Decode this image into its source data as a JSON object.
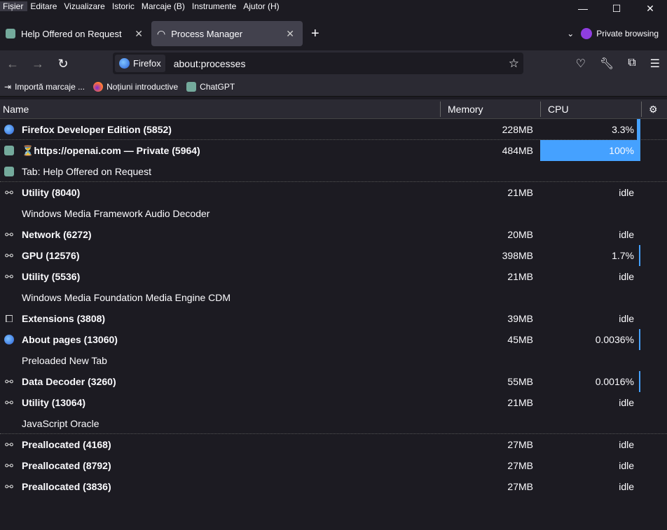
{
  "menu": [
    "Fișier",
    "Editare",
    "Vizualizare",
    "Istoric",
    "Marcaje (B)",
    "Instrumente",
    "Ajutor (H)"
  ],
  "window_controls": {
    "minimize": "—",
    "maximize": "☐",
    "close": "✕"
  },
  "tabs": [
    {
      "label": "Help Offered on Request",
      "icon": "chatgpt-icon"
    },
    {
      "label": "Process Manager",
      "icon": "gauge-icon"
    }
  ],
  "private_label": "Private browsing",
  "urlbar": {
    "identity": "Firefox",
    "url": "about:processes"
  },
  "bookmarks": [
    "Importă marcaje ...",
    "Noțiuni introductive",
    "ChatGPT"
  ],
  "columns": {
    "name": "Name",
    "memory": "Memory",
    "cpu": "CPU"
  },
  "accent": "#45a1ff",
  "rows": [
    {
      "icon": "firefox-icon",
      "name": "Firefox Developer Edition (5852)",
      "bold": true,
      "memory": "228MB",
      "cpu": "3.3%",
      "cpu_fraction": 0.033
    },
    {
      "icon": "chatgpt-icon",
      "name": "⏳https://openai.com — Private (5964)",
      "bold": true,
      "memory": "484MB",
      "cpu": "100%",
      "cpu_fraction": 1.0
    },
    {
      "icon": "chatgpt-icon",
      "name": "Tab: Help Offered on Request",
      "bold": false,
      "memory": "",
      "cpu": ""
    },
    {
      "icon": "plugin-icon",
      "name": "Utility (8040)",
      "bold": true,
      "memory": "21MB",
      "cpu": "idle"
    },
    {
      "icon": "",
      "name": "Windows Media Framework Audio Decoder",
      "bold": false,
      "memory": "",
      "cpu": ""
    },
    {
      "icon": "plugin-icon",
      "name": "Network (6272)",
      "bold": true,
      "memory": "20MB",
      "cpu": "idle"
    },
    {
      "icon": "plugin-icon",
      "name": "GPU (12576)",
      "bold": true,
      "memory": "398MB",
      "cpu": "1.7%",
      "cpu_fraction": 0.017
    },
    {
      "icon": "plugin-icon",
      "name": "Utility (5536)",
      "bold": true,
      "memory": "21MB",
      "cpu": "idle"
    },
    {
      "icon": "",
      "name": "Windows Media Foundation Media Engine CDM",
      "bold": false,
      "memory": "",
      "cpu": ""
    },
    {
      "icon": "extension-icon",
      "name": "Extensions (3808)",
      "bold": true,
      "memory": "39MB",
      "cpu": "idle"
    },
    {
      "icon": "firefox-icon",
      "name": "About pages (13060)",
      "bold": true,
      "memory": "45MB",
      "cpu": "0.0036%",
      "cpu_fraction": 4e-05
    },
    {
      "icon": "",
      "name": "Preloaded New Tab",
      "bold": false,
      "memory": "",
      "cpu": ""
    },
    {
      "icon": "plugin-icon",
      "name": "Data Decoder (3260)",
      "bold": true,
      "memory": "55MB",
      "cpu": "0.0016%",
      "cpu_fraction": 2e-05
    },
    {
      "icon": "plugin-icon",
      "name": "Utility (13064)",
      "bold": true,
      "memory": "21MB",
      "cpu": "idle"
    },
    {
      "icon": "",
      "name": "JavaScript Oracle",
      "bold": false,
      "memory": "",
      "cpu": ""
    },
    {
      "icon": "plugin-icon",
      "name": "Preallocated (4168)",
      "bold": true,
      "memory": "27MB",
      "cpu": "idle"
    },
    {
      "icon": "plugin-icon",
      "name": "Preallocated (8792)",
      "bold": true,
      "memory": "27MB",
      "cpu": "idle"
    },
    {
      "icon": "plugin-icon",
      "name": "Preallocated (3836)",
      "bold": true,
      "memory": "27MB",
      "cpu": "idle"
    }
  ]
}
